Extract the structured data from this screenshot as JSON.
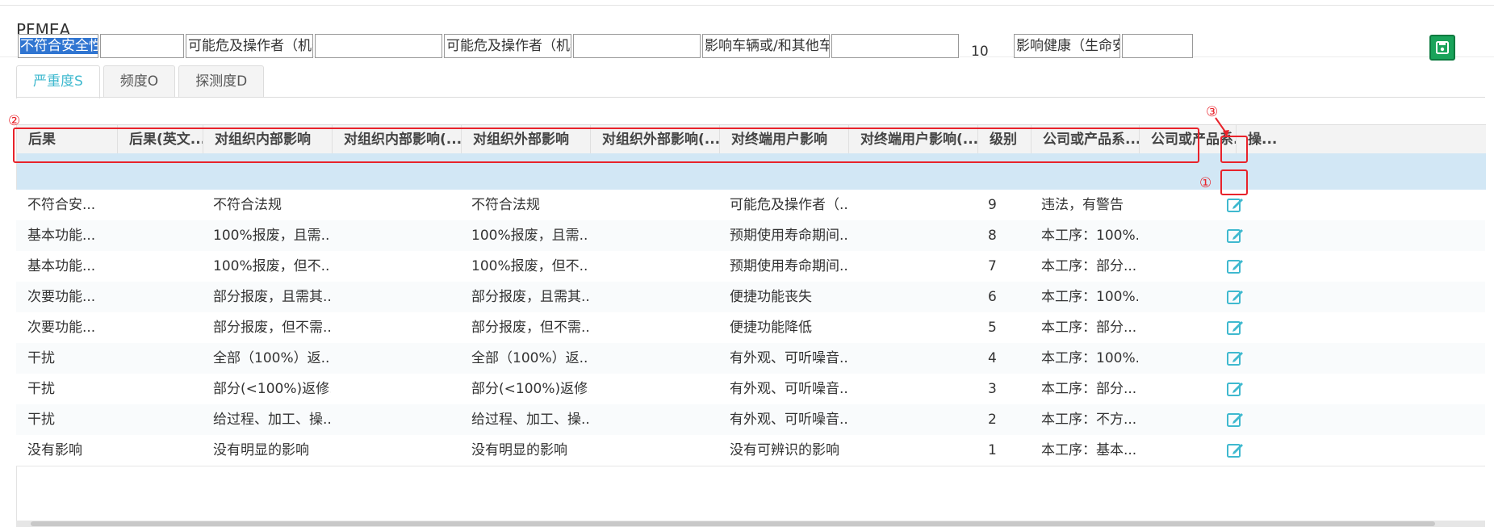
{
  "page": {
    "title": "PFMEA"
  },
  "tabs": [
    {
      "label": "严重度S",
      "active": true
    },
    {
      "label": "频度O",
      "active": false
    },
    {
      "label": "探测度D",
      "active": false
    }
  ],
  "columns": [
    "后果",
    "后果(英文...",
    "对组织内部影响",
    "对组织内部影响(...",
    "对组织外部影响",
    "对组织外部影响(...",
    "对终端用户影响",
    "对终端用户影响(...",
    "级别",
    "公司或产品系...",
    "公司或产品系...",
    "操..."
  ],
  "edit_row": {
    "consequence": "不符合安全性 或",
    "consequence_en": "",
    "internal": "可能危及操作者（机器或",
    "internal_en": "",
    "external": "可能危及操作者（机器或",
    "external_en": "",
    "end_user": "影响车辆或/和其他车辆",
    "end_user_en": "",
    "level": "10",
    "company": "影响健康（生命安全",
    "company2": ""
  },
  "rows": [
    {
      "consequence": "不符合安...",
      "internal": "不符合法规",
      "external": "不符合法规",
      "end_user": "可能危及操作者（...",
      "level": "9",
      "company": "违法，有警告"
    },
    {
      "consequence": "基本功能...",
      "internal": "100%报废，且需...",
      "external": "100%报废，且需...",
      "end_user": "预期使用寿命期间...",
      "level": "8",
      "company": "本工序：100%..."
    },
    {
      "consequence": "基本功能...",
      "internal": "100%报废，但不...",
      "external": "100%报废，但不...",
      "end_user": "预期使用寿命期间...",
      "level": "7",
      "company": "本工序：部分..."
    },
    {
      "consequence": "次要功能...",
      "internal": "部分报废，且需其...",
      "external": "部分报废，且需其...",
      "end_user": "便捷功能丧失",
      "level": "6",
      "company": "本工序：100%..."
    },
    {
      "consequence": "次要功能...",
      "internal": "部分报废，但不需...",
      "external": "部分报废，但不需...",
      "end_user": "便捷功能降低",
      "level": "5",
      "company": "本工序：部分..."
    },
    {
      "consequence": "干扰",
      "internal": "全部（100%）返...",
      "external": "全部（100%）返...",
      "end_user": "有外观、可听噪音...",
      "level": "4",
      "company": "本工序：100%..."
    },
    {
      "consequence": "干扰",
      "internal": "部分(<100%)返修...",
      "external": "部分(<100%)返修...",
      "end_user": "有外观、可听噪音...",
      "level": "3",
      "company": "本工序：部分..."
    },
    {
      "consequence": "干扰",
      "internal": "给过程、加工、操...",
      "external": "给过程、加工、操...",
      "end_user": "有外观、可听噪音...",
      "level": "2",
      "company": "本工序：不方..."
    },
    {
      "consequence": "没有影响",
      "internal": "没有明显的影响",
      "external": "没有明显的影响",
      "end_user": "没有可辨识的影响",
      "level": "1",
      "company": "本工序：基本..."
    }
  ],
  "annotations": {
    "one": "①",
    "two": "②",
    "three": "③"
  },
  "colors": {
    "accent": "#3fb9cf",
    "annotation": "#e8232b",
    "save": "#19a35a"
  }
}
